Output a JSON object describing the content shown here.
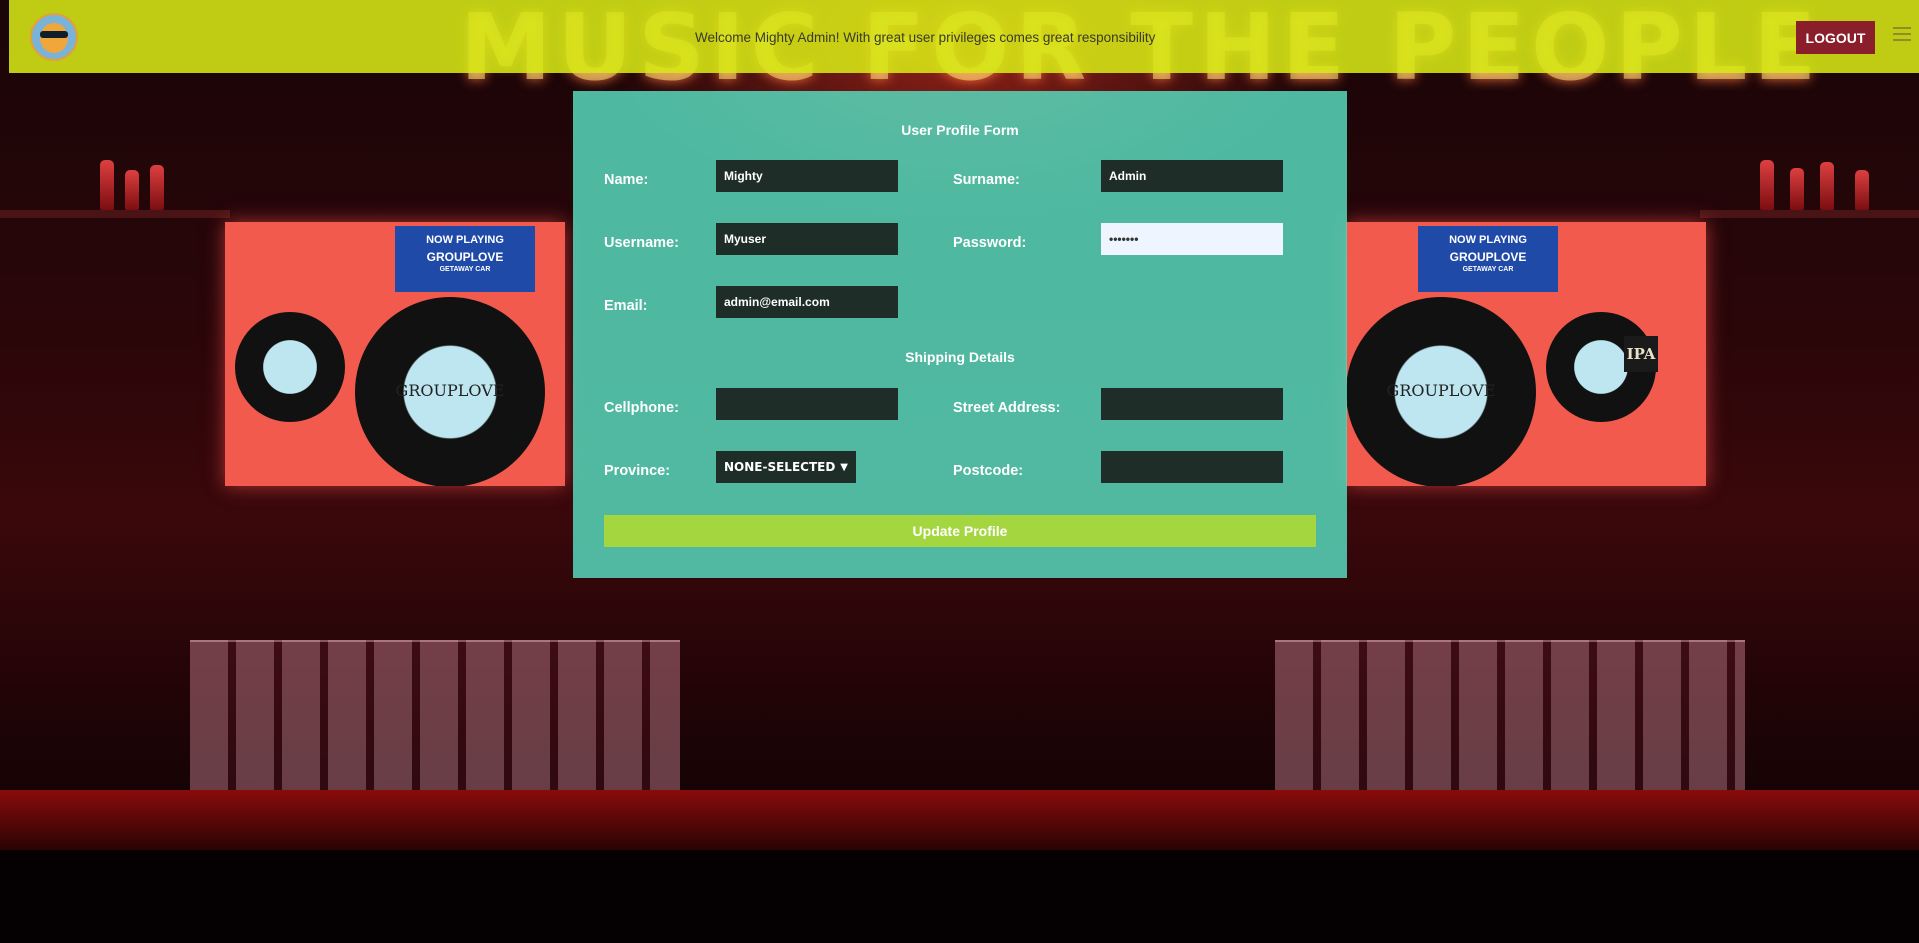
{
  "header": {
    "welcome_text": "Welcome Mighty Admin! With great user privileges comes great responsibility",
    "logout_label": "LOGOUT",
    "logo_icon": "lion-logo-icon",
    "menu_icon": "hamburger-menu-icon"
  },
  "background": {
    "neon_sign": "MUSIC FOR THE PEOPLE",
    "screen_left": {
      "now_playing": "NOW PLAYING",
      "band": "GROUPLOVE",
      "album": "GETAWAY CAR",
      "vinyl_label": "GROUPLOVE"
    },
    "screen_right": {
      "now_playing": "NOW PLAYING",
      "band": "GROUPLOVE",
      "album": "GETAWAY CAR",
      "vinyl_label": "GROUPLOVE"
    },
    "tap_label": "IPA"
  },
  "form": {
    "title": "User Profile Form",
    "name_label": "Name:",
    "name_value": "Mighty",
    "surname_label": "Surname:",
    "surname_value": "Admin",
    "username_label": "Username:",
    "username_value": "Myuser",
    "password_label": "Password:",
    "password_value": "•••••••",
    "email_label": "Email:",
    "email_value": "admin@email.com",
    "shipping_title": "Shipping Details",
    "cellphone_label": "Cellphone:",
    "cellphone_value": "",
    "street_label": "Street Address:",
    "street_value": "",
    "province_label": "Province:",
    "province_selected": "NONE-SELECTED",
    "postcode_label": "Postcode:",
    "postcode_value": "",
    "update_label": "Update Profile"
  },
  "colors": {
    "header_bg": "#d6e814",
    "panel_bg": "#56d6ba",
    "input_bg": "#1f2d29",
    "logout_bg": "#8a1e2a",
    "update_bg": "#a4d63f"
  }
}
